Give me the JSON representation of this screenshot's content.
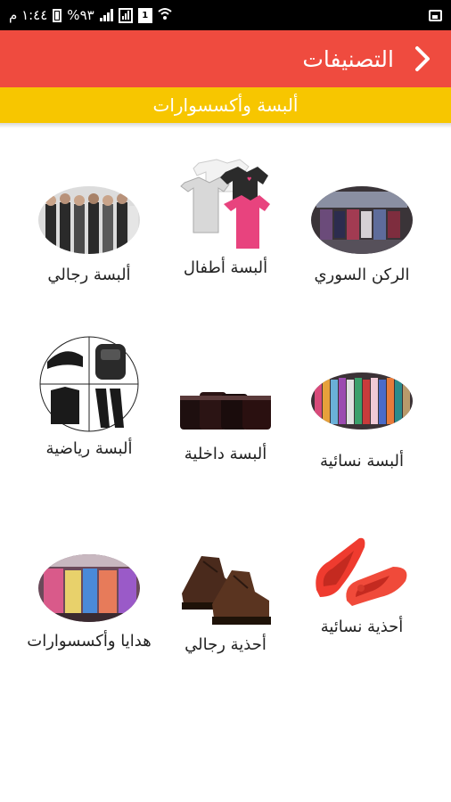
{
  "status_bar": {
    "time": "١:٤٤ م",
    "battery": "%٩٣",
    "sim1": "1"
  },
  "app_bar": {
    "title": "التصنيفات",
    "back_icon": "chevron-right-icon"
  },
  "sub_bar": {
    "title": "ألبسة وأكسسوارات"
  },
  "categories": [
    {
      "label": "الركن السوري"
    },
    {
      "label": "ألبسة أطفال"
    },
    {
      "label": "ألبسة رجالي"
    },
    {
      "label": "ألبسة نسائية"
    },
    {
      "label": "ألبسة داخلية"
    },
    {
      "label": "ألبسة رياضية"
    },
    {
      "label": "أحذية نسائية"
    },
    {
      "label": "أحذية رجالي"
    },
    {
      "label": "هدايا وأكسسوارات"
    }
  ],
  "colors": {
    "app_bar": "#ef4b3f",
    "sub_bar": "#f7c600"
  }
}
